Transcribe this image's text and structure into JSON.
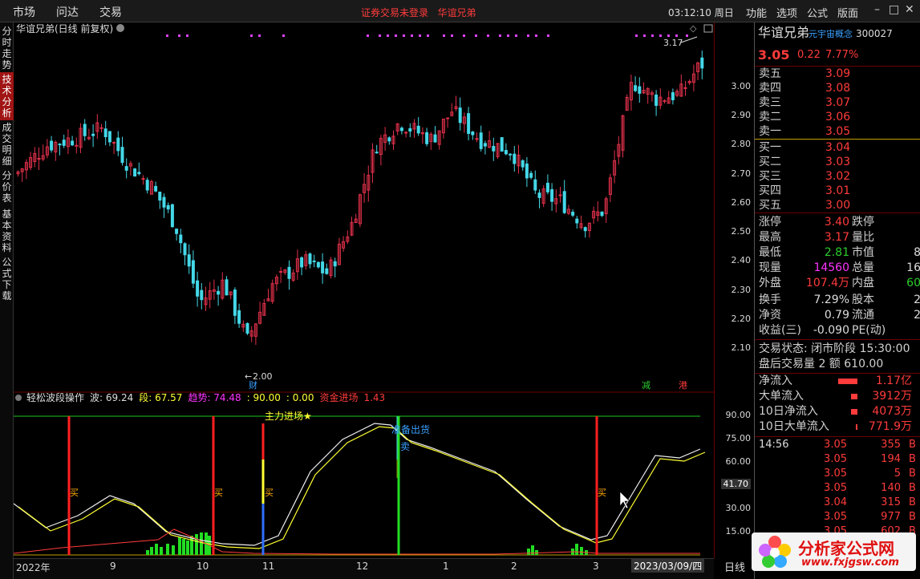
{
  "menu": {
    "market": "市场",
    "ask": "问达",
    "trade": "交易",
    "login": "证券交易未登录",
    "stock": "华谊兄弟",
    "clock": "03:12:10 周日",
    "func": "功能",
    "option": "选项",
    "formula": "公式",
    "layout": "版面"
  },
  "side_tabs": [
    "分时走势",
    "技术分析",
    "成交明细",
    "分价表",
    "基本资料",
    "公式下载"
  ],
  "chart": {
    "title": "华谊兄弟(日线 前复权)",
    "high_label": "3.17",
    "low_label": "2.00",
    "mark_cai": "财",
    "mark_jian": "减",
    "mark_gang": "港",
    "ind_title": "轻松波段操作",
    "ind_items": [
      {
        "t": "波: 69.24",
        "c": "#ddd"
      },
      {
        "t": "段: 67.57",
        "c": "#ffff33"
      },
      {
        "t": "趋势: 74.48",
        "c": "#ff33ff"
      },
      {
        "t": ": 90.00",
        "c": "#ffff33"
      },
      {
        "t": ": 0.00",
        "c": "#ffff33"
      },
      {
        "t": "资金进场",
        "c": "#ff3b3b"
      },
      {
        "t": "1.43",
        "c": "#ff3b3b"
      }
    ],
    "main_in": "主力进场★",
    "out_label": "准备出货",
    "sell": "卖",
    "buy": "买",
    "price_ticks": [
      "3.00",
      "2.90",
      "2.80",
      "2.70",
      "2.60",
      "2.50",
      "2.40",
      "2.30",
      "2.20",
      "2.10"
    ],
    "ind_ticks": [
      "90.00",
      "75.00",
      "60.00",
      "30.00",
      "15.00"
    ],
    "cur_ind": "41.70",
    "xlabels": [
      "2022年",
      "9",
      "10",
      "11",
      "12",
      "1",
      "2",
      "3",
      "4"
    ],
    "date_box": "2023/03/09/四",
    "period": "日线"
  },
  "chart_data": {
    "type": "candlestick",
    "title": "华谊兄弟(日线 前复权)",
    "yrange": [
      2.0,
      3.17
    ],
    "high": 3.17,
    "low": 2.0,
    "indicator": {
      "name": "轻松波段操作",
      "wave": 69.24,
      "band": 67.57,
      "trend": 74.48,
      "levels": [
        90.0,
        0.0
      ],
      "fund_in": 1.43,
      "current": 41.7
    }
  },
  "quote": {
    "name": "华谊兄弟",
    "concept": "元宇宙概念",
    "code": "300027",
    "price": "3.05",
    "change": "0.22",
    "pct": "7.77%",
    "asks": [
      {
        "l": "卖五",
        "p": "3.09"
      },
      {
        "l": "卖四",
        "p": "3.08"
      },
      {
        "l": "卖三",
        "p": "3.07"
      },
      {
        "l": "卖二",
        "p": "3.06"
      },
      {
        "l": "卖一",
        "p": "3.05"
      }
    ],
    "bids": [
      {
        "l": "买一",
        "p": "3.04"
      },
      {
        "l": "买二",
        "p": "3.03"
      },
      {
        "l": "买三",
        "p": "3.02"
      },
      {
        "l": "买四",
        "p": "3.01"
      },
      {
        "l": "买五",
        "p": "3.00"
      }
    ],
    "limit_up_l": "涨停",
    "limit_up": "3.40",
    "limit_dn_l": "跌停",
    "high_l": "最高",
    "high": "3.17",
    "vol_ratio_l": "量比",
    "low_l": "最低",
    "low": "2.81",
    "mcap_l": "市值",
    "mcap": "8",
    "cur_vol_l": "现量",
    "cur_vol": "14560",
    "tot_vol_l": "总量",
    "tot_vol": "16",
    "outer_l": "外盘",
    "outer": "107.4万",
    "inner_l": "内盘",
    "inner": "60",
    "turn_l": "换手",
    "turn": "7.29%",
    "cap_l": "股本",
    "cap": "2",
    "na_l": "净资",
    "na": "0.79",
    "float_l": "流通",
    "float": "2",
    "eps_l": "收益(三)",
    "eps": "-0.090",
    "pe_l": "PE(动)",
    "status": "交易状态: 闭市阶段 15:30:00",
    "after": "盘后交易量 2 额 610.00",
    "flows": [
      {
        "l": "净流入",
        "v": "1.17亿"
      },
      {
        "l": "大单流入",
        "v": "3912万"
      },
      {
        "l": "10日净流入",
        "v": "4073万"
      },
      {
        "l": "10日大单流入",
        "v": "771.9万"
      }
    ],
    "ticks": [
      {
        "t": "14:56",
        "p": "3.05",
        "v": "355"
      },
      {
        "t": "",
        "p": "3.05",
        "v": "194"
      },
      {
        "t": "",
        "p": "3.05",
        "v": "5"
      },
      {
        "t": "",
        "p": "3.05",
        "v": "140"
      },
      {
        "t": "",
        "p": "3.04",
        "v": "315"
      },
      {
        "t": "",
        "p": "3.05",
        "v": "977"
      },
      {
        "t": "",
        "p": "3.05",
        "v": "602"
      }
    ]
  },
  "watermark": {
    "title": "分析家公式网",
    "url": "www.fxjgsw.com"
  }
}
